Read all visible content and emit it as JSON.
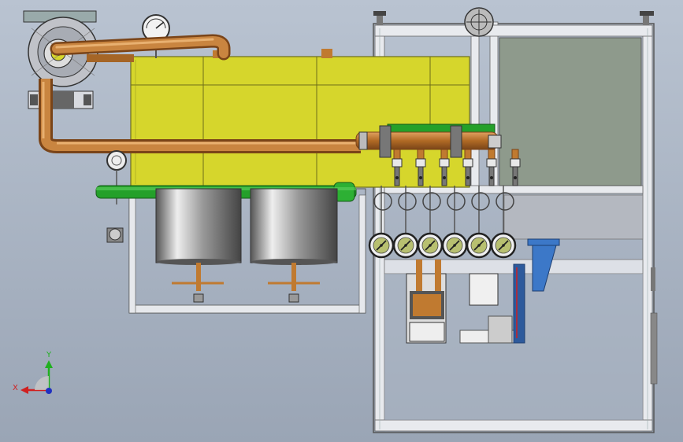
{
  "viewport": {
    "background_top": "#b9c3d1",
    "background_bottom": "#9aa5b5"
  },
  "colors": {
    "tank": "#d6d62c",
    "tank_line": "#6d6d1a",
    "copper": "#c07a30",
    "copper_dark": "#8a5220",
    "green": "#24a02a",
    "steel": "#c8ccd4",
    "frame": "#e6e8ec",
    "panel": "#8e9a8c",
    "blue_part": "#3c78c8"
  },
  "triad": {
    "x_label": "X",
    "y_label": "Y",
    "x_color": "#d02020",
    "y_color": "#20b020",
    "z_color": "#2030c0"
  },
  "gauge_count": 6,
  "valve_count": 6
}
